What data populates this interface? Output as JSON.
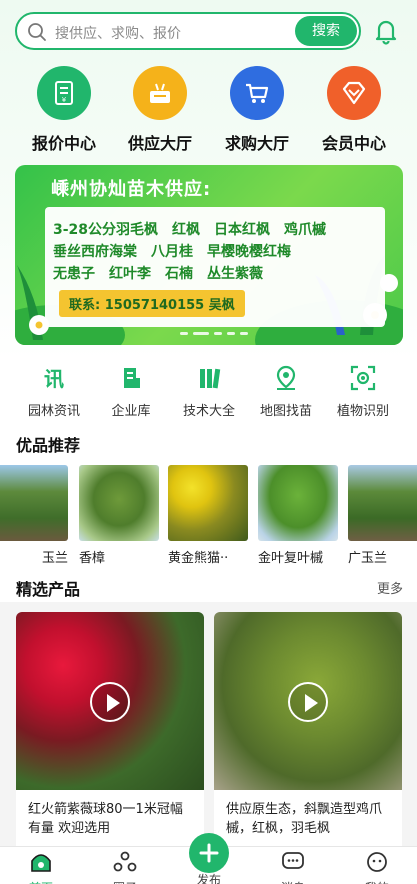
{
  "search": {
    "placeholder": "搜供应、求购、报价",
    "button_label": "搜索"
  },
  "main_nav": [
    {
      "label": "报价中心",
      "icon": "price-sheet-icon",
      "color": "#21b66c"
    },
    {
      "label": "供应大厅",
      "icon": "supply-box-icon",
      "color": "#f5b21a"
    },
    {
      "label": "求购大厅",
      "icon": "shopping-cart-icon",
      "color": "#2f6de0"
    },
    {
      "label": "会员中心",
      "icon": "diamond-icon",
      "color": "#f0602a"
    }
  ],
  "banner": {
    "title": "嵊州协灿苗木供应:",
    "lines": [
      "3-28公分羽毛枫　红枫　日本红枫　鸡爪槭",
      "垂丝西府海棠　八月桂　早樱晚樱红梅",
      "无患子　红叶李　石楠　丛生紫薇"
    ],
    "contact": "联系: 15057140155 吴枫"
  },
  "sub_nav": [
    {
      "label": "园林资讯",
      "icon": "news-icon"
    },
    {
      "label": "企业库",
      "icon": "company-icon"
    },
    {
      "label": "技术大全",
      "icon": "books-icon"
    },
    {
      "label": "地图找苗",
      "icon": "map-pin-icon"
    },
    {
      "label": "植物识别",
      "icon": "plant-scan-icon"
    }
  ],
  "recommend": {
    "title": "优品推荐",
    "items": [
      {
        "label": "玉兰"
      },
      {
        "label": "香樟"
      },
      {
        "label": "黄金熊猫··"
      },
      {
        "label": "金叶复叶槭"
      },
      {
        "label": "广玉兰"
      }
    ]
  },
  "products": {
    "title": "精选产品",
    "more": "更多",
    "items": [
      {
        "title": "红火箭紫薇球80一1米冠幅有量 欢迎选用"
      },
      {
        "title": "供应原生态，斜飘造型鸡爪槭，红枫，羽毛枫"
      }
    ]
  },
  "tabbar": [
    {
      "label": "首页",
      "icon": "home-icon",
      "active": true
    },
    {
      "label": "圈子",
      "icon": "circle-icon"
    },
    {
      "label": "发布",
      "icon": "plus-icon"
    },
    {
      "label": "消息",
      "icon": "message-icon"
    },
    {
      "label": "我的",
      "icon": "profile-icon"
    }
  ],
  "colors": {
    "brand_green": "#21b66c"
  }
}
